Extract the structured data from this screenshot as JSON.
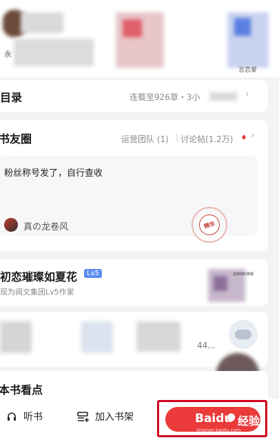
{
  "top_strip": {
    "left_caption": "永",
    "right_caption": "言恋爱"
  },
  "catalog": {
    "title": "目录",
    "status": "连载至926章・3小"
  },
  "book_circle": {
    "title": "书友圈",
    "ops_team": "运营团队 (1)",
    "discussions": "讨论帖(1.2万)",
    "post_text": "粉丝称号发了，自行查收",
    "author": "真の龙卷风",
    "stamp_text": "精华"
  },
  "author_section": {
    "name": "初恋璀璨如夏花",
    "level_badge": "Lv5",
    "subtitle": "现为阅文集团Lv5作家",
    "book_caption": "逆袭喝所要都"
  },
  "fans_row": {
    "count_text": "44..."
  },
  "highlights": {
    "title": "本书看点"
  },
  "bottom_bar": {
    "listen_label": "听书",
    "add_shelf_label": "加入书架",
    "watermark_brand": "Baidu",
    "watermark_cn": "经验",
    "watermark_url": "jingyan.baidu.com"
  },
  "colors": {
    "accent_red": "#ea3a3a",
    "highlight_box": "#d0021b",
    "level_badge_bg": "#5b8def"
  }
}
